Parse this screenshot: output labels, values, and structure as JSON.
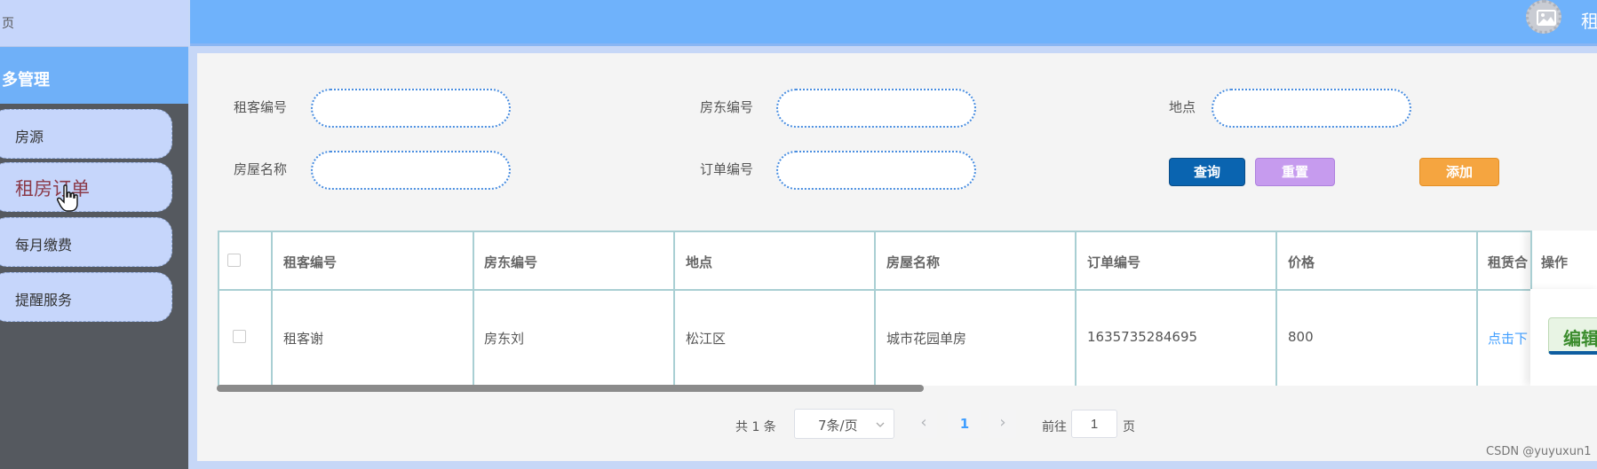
{
  "sidebar": {
    "top_label": "页",
    "group_label": "业务管理",
    "group_label_visible": "多管理",
    "items": [
      {
        "label": "房源"
      },
      {
        "label": "租房订单"
      },
      {
        "label": "每月缴费"
      },
      {
        "label": "提醒服务"
      }
    ]
  },
  "header": {
    "text": "租"
  },
  "filters": {
    "tenant_no_label": "租客编号",
    "landlord_no_label": "房东编号",
    "location_label": "地点",
    "house_name_label": "房屋名称",
    "order_no_label": "订单编号",
    "tenant_no_value": "",
    "landlord_no_value": "",
    "location_value": "",
    "house_name_value": "",
    "order_no_value": ""
  },
  "buttons": {
    "search": "查询",
    "reset": "重置",
    "add": "添加"
  },
  "table": {
    "columns": [
      "租客编号",
      "房东编号",
      "地点",
      "房屋名称",
      "订单编号",
      "价格",
      "租赁合",
      "操作"
    ],
    "rows": [
      {
        "tenant_no": "租客谢",
        "landlord_no": "房东刘",
        "location": "松江区",
        "house_name": "城市花园单房",
        "order_no": "1635735284695",
        "price": "800",
        "contract": "点击下",
        "edit": "编辑"
      }
    ]
  },
  "pagination": {
    "total": "共 1 条",
    "page_size": "7条/页",
    "prev": "‹",
    "current_page": "1",
    "next": "›",
    "goto_label": "前往",
    "goto_value": "1",
    "page_suffix": "页"
  },
  "watermark": "CSDN @yuyuxun1",
  "icons": {
    "avatar": "image-icon",
    "cursor": "hand-pointer-icon",
    "dropdown": "chevron-down-icon"
  }
}
